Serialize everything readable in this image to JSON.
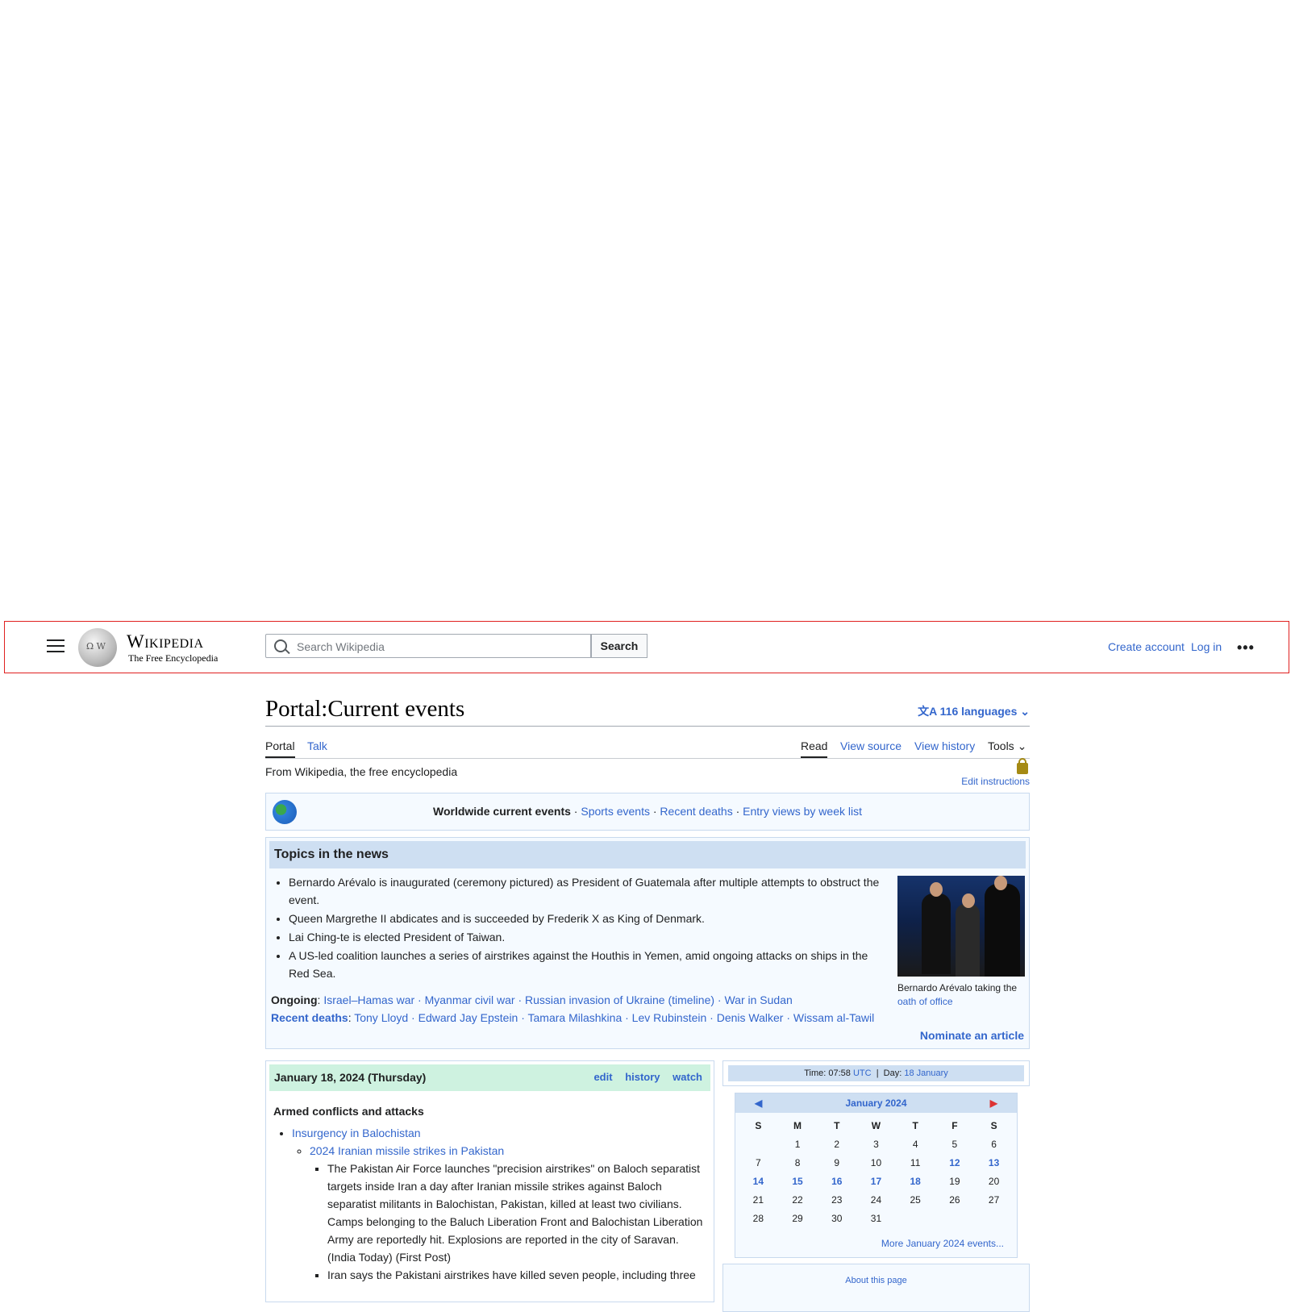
{
  "header": {
    "wordmark": "Wikipedia",
    "tagline": "The Free Encyclopedia",
    "search_placeholder": "Search Wikipedia",
    "search_button": "Search",
    "create_account": "Create account",
    "log_in": "Log in",
    "more": "•••"
  },
  "page": {
    "title": "Portal:Current events",
    "languages": "116 languages",
    "tabs_left": [
      "Portal",
      "Talk"
    ],
    "tabs_right": [
      "Read",
      "View source",
      "View history",
      "Tools"
    ],
    "from": "From Wikipedia, the free encyclopedia",
    "edit_instructions": "Edit instructions"
  },
  "worldbar": {
    "current": "Worldwide current events",
    "links": [
      "Sports events",
      "Recent deaths",
      "Entry views by week list"
    ]
  },
  "news": {
    "heading": "Topics in the news",
    "items": [
      "Bernardo Arévalo is inaugurated (ceremony pictured) as President of Guatemala after multiple attempts to obstruct the event.",
      "Queen Margrethe II abdicates and is succeeded by Frederik X as King of Denmark.",
      "Lai Ching-te is elected President of Taiwan.",
      "A US-led coalition launches a series of airstrikes against the Houthis in Yemen, amid ongoing attacks on ships in the Red Sea."
    ],
    "caption": "Bernardo Arévalo taking the",
    "caption_link": "oath of office",
    "ongoing_label": "Ongoing",
    "ongoing": "Israel–Hamas war · Myanmar civil war · Russian invasion of Ukraine (timeline) · War in Sudan",
    "deaths_label": "Recent deaths",
    "deaths": "Tony Lloyd · Edward Jay Epstein · Tamara Milashkina · Lev Rubinstein · Denis Walker · Wissam al-Tawil",
    "nominate": "Nominate an article"
  },
  "day": {
    "date": "January 18, 2024 (Thursday)",
    "actions": [
      "edit",
      "history",
      "watch"
    ],
    "category": "Armed conflicts and attacks",
    "l1": "Insurgency in Balochistan",
    "l2": "2024 Iranian missile strikes in Pakistan",
    "p1": "The Pakistan Air Force launches \"precision airstrikes\" on Baloch separatist targets inside Iran a day after Iranian missile strikes against Baloch separatist militants in Balochistan, Pakistan, killed at least two civilians. Camps belonging to the Baluch Liberation Front and Balochistan Liberation Army are reportedly hit. Explosions are reported in the city of Saravan. (India Today) (First Post)",
    "p2": "Iran says the Pakistani airstrikes have killed seven people, including three"
  },
  "time": {
    "time_label": "Time",
    "time_value": "07:58",
    "utc": "UTC",
    "day_label": "Day",
    "day_value": "18 January"
  },
  "calendar": {
    "month": "January 2024",
    "prev": "◀",
    "next": "▶",
    "weekdays": [
      "S",
      "M",
      "T",
      "W",
      "T",
      "F",
      "S"
    ],
    "more": "More January 2024 events..."
  },
  "about": {
    "text": "About this page"
  }
}
